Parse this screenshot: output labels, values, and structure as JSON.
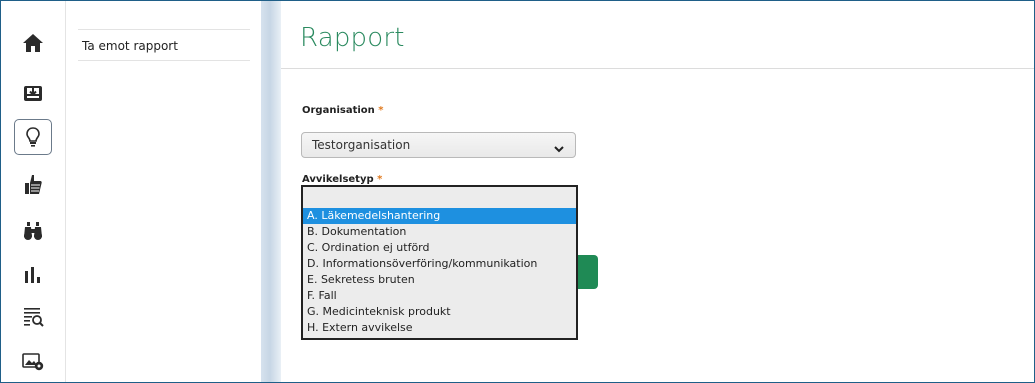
{
  "nav": {
    "icons": [
      "home-icon",
      "inbox-download-icon",
      "lightbulb-icon",
      "thumbs-up-icon",
      "binoculars-icon",
      "bar-chart-icon",
      "list-search-icon",
      "image-settings-icon"
    ],
    "active_index": 2
  },
  "subnav": {
    "items": [
      {
        "label": "Ta emot rapport"
      }
    ]
  },
  "main": {
    "title": "Rapport",
    "organisation": {
      "label": "Organisation",
      "required_mark": "*",
      "selected_value": "Testorganisation"
    },
    "avvikelsetyp": {
      "label": "Avvikelsetyp",
      "required_mark": "*",
      "options": [
        "A. Läkemedelshantering",
        "B. Dokumentation",
        "C. Ordination ej utförd",
        "D. Informationsöverföring/kommunikation",
        "E. Sekretess bruten",
        "F. Fall",
        "G. Medicinteknisk produkt",
        "H. Extern avvikelse"
      ],
      "highlighted_index": 0
    }
  },
  "colors": {
    "accent_green": "#2a8a5f",
    "button_green": "#1f8a55",
    "selection_blue": "#1e90e0",
    "required_orange": "#e07a1f"
  }
}
